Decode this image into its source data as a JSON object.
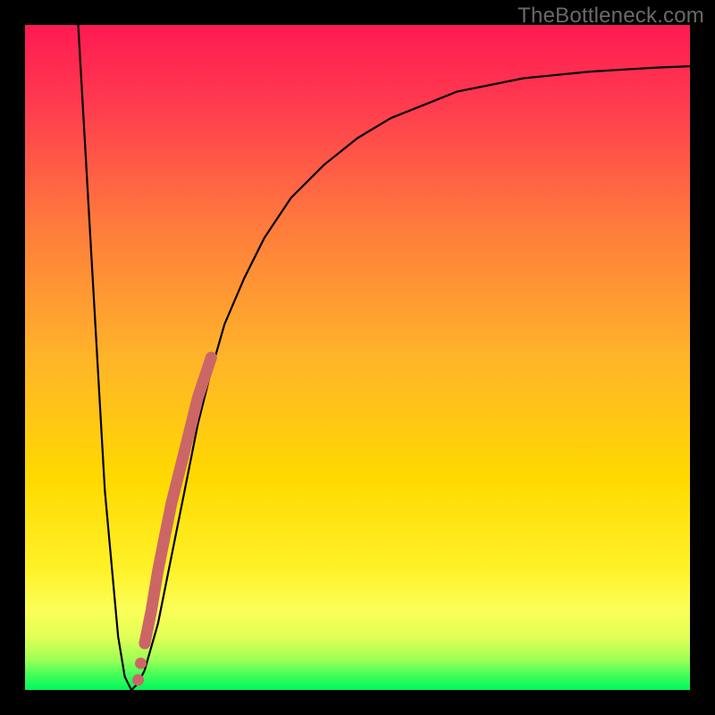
{
  "watermark": "TheBottleneck.com",
  "colors": {
    "frame": "#000000",
    "gradient_top": "#ff1a52",
    "gradient_mid": "#ffd000",
    "gradient_yellow_band": "#feff5a",
    "gradient_green": "#00f65c",
    "curve": "#000000",
    "marker": "#cc6666"
  },
  "chart_data": {
    "type": "line",
    "title": "",
    "xlabel": "",
    "ylabel": "",
    "xlim": [
      0,
      100
    ],
    "ylim": [
      0,
      100
    ],
    "grid": false,
    "series": [
      {
        "name": "bottleneck-curve",
        "x": [
          8,
          10,
          12,
          14,
          15,
          16,
          17,
          18,
          20,
          22,
          24,
          26,
          28,
          30,
          33,
          36,
          40,
          45,
          50,
          55,
          60,
          65,
          70,
          75,
          80,
          85,
          90,
          95,
          100
        ],
        "y": [
          100,
          65,
          30,
          8,
          2,
          0,
          1,
          3,
          10,
          20,
          30,
          40,
          48,
          55,
          62,
          68,
          74,
          79,
          83,
          86,
          88,
          90,
          91,
          92,
          92.5,
          93,
          93.3,
          93.6,
          93.8
        ]
      }
    ],
    "markers": {
      "name": "highlighted-segment",
      "x": [
        18,
        19,
        20,
        21,
        22,
        23,
        24,
        25,
        26,
        27,
        28
      ],
      "y": [
        7,
        12,
        18,
        23,
        28,
        32,
        36,
        40,
        44,
        47,
        50
      ]
    },
    "optimum_x": 16
  }
}
